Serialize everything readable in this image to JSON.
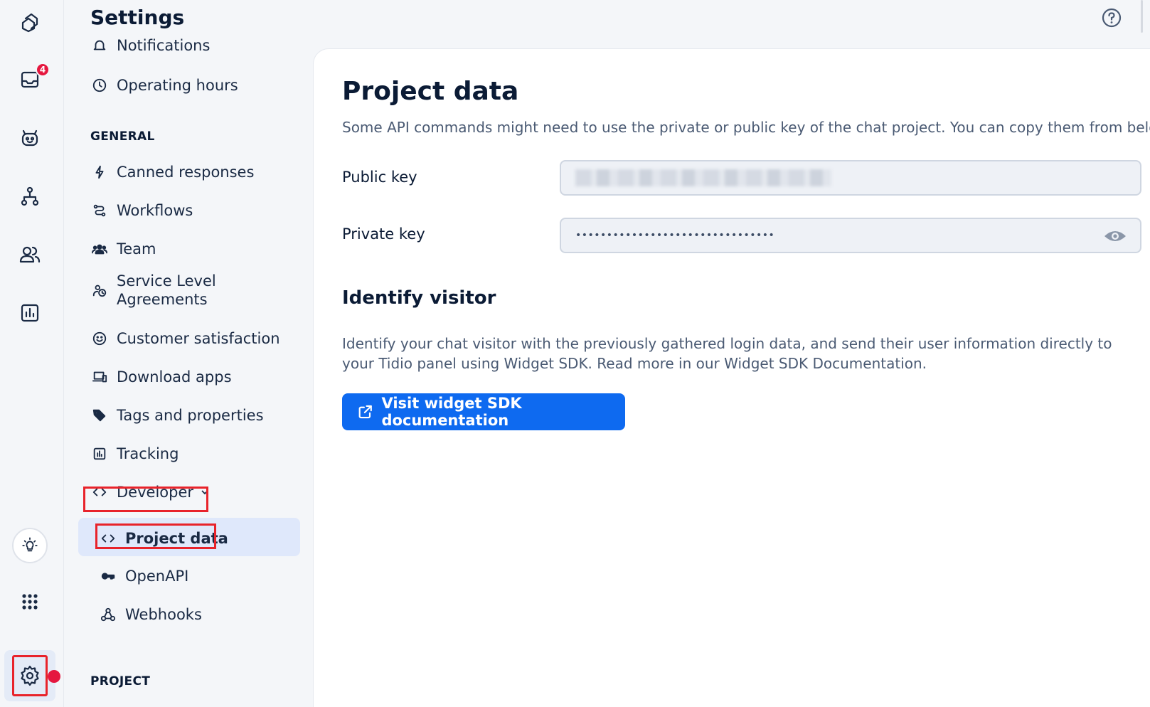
{
  "header": {
    "title": "Settings"
  },
  "rail": {
    "inbox_badge": "4"
  },
  "nav": {
    "notifications_partial": "Notifications",
    "operating_hours": "Operating hours",
    "general_heading": "GENERAL",
    "canned_responses": "Canned responses",
    "workflows": "Workflows",
    "team": "Team",
    "sla_line1": "Service Level",
    "sla_line2": "Agreements",
    "customer_satisfaction": "Customer satisfaction",
    "download_apps": "Download apps",
    "tags_properties": "Tags and properties",
    "tracking": "Tracking",
    "developer": "Developer",
    "project_data": "Project data",
    "openapi": "OpenAPI",
    "webhooks": "Webhooks",
    "project_heading": "PROJECT"
  },
  "main": {
    "title": "Project data",
    "description": "Some API commands might need to use the private or public key of the chat project. You can copy them from below:",
    "public_key_label": "Public key",
    "private_key_label": "Private key",
    "private_key_value": "••••••••••••••••••••••••••••••••",
    "identify_title": "Identify visitor",
    "identify_text": "Identify your chat visitor with the previously gathered login data, and send their user information directly to your Tidio panel using Widget SDK. Read more in our Widget SDK Documentation.",
    "sdk_button": "Visit widget SDK documentation"
  },
  "colors": {
    "accent": "#0e6af0",
    "highlight": "#e8232b",
    "badge": "#e5173f"
  }
}
